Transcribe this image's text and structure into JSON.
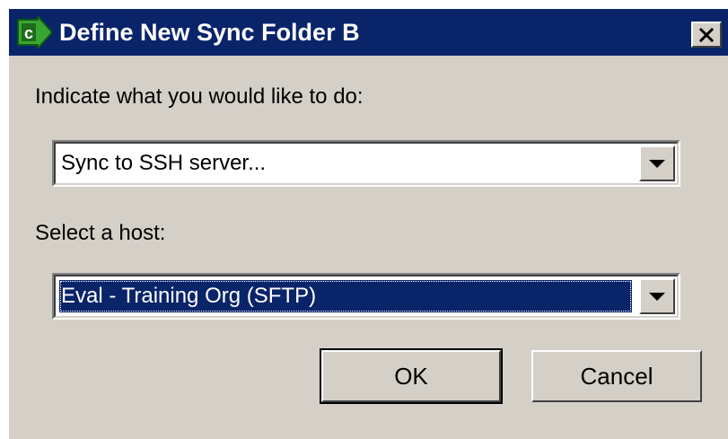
{
  "window": {
    "title": "Define New Sync Folder B",
    "icon": "app-c-arrow-icon",
    "close_glyph": "✕"
  },
  "action": {
    "label": "Indicate what you would like to do:",
    "selected": "Sync to SSH server..."
  },
  "host": {
    "label": "Select a host:",
    "selected": "Eval - Training Org (SFTP)"
  },
  "buttons": {
    "ok": "OK",
    "cancel": "Cancel"
  },
  "colors": {
    "titlebar": "#0a246a",
    "dialog_face": "#d4d0c8",
    "selection": "#0a246a",
    "icon_green": "#3aa632"
  }
}
